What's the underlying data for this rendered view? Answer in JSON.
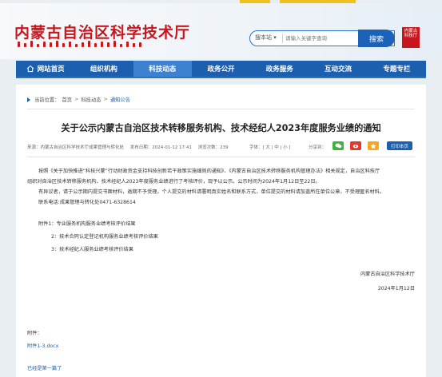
{
  "header": {
    "title": "内蒙古自治区科学技术厅",
    "seal_text": "内蒙古科技厅"
  },
  "search": {
    "scope": "搜本站",
    "placeholder": "请输入关键字查询",
    "button": "搜索"
  },
  "nav": {
    "items": [
      {
        "label": "网站首页"
      },
      {
        "label": "组织机构"
      },
      {
        "label": "科技动态"
      },
      {
        "label": "政务公开"
      },
      {
        "label": "政务服务"
      },
      {
        "label": "互动交流"
      },
      {
        "label": "专题专栏"
      }
    ],
    "active_index": 2
  },
  "breadcrumb": {
    "prefix": "当前位置：",
    "items": [
      "首页",
      "科技动态",
      "通知公告"
    ],
    "separator": ">"
  },
  "article": {
    "title": "关于公示内蒙古自治区技术转移服务机构、技术经纪人2023年度服务业绩的通知",
    "source": "来源：内蒙古自治区科学技术厅成果管理与转化处",
    "published": "发布日期：2024-01-12 17:41",
    "views": "浏览次数：239",
    "font_size_ctl": "字体：[ 大 | 中 | 小 ]",
    "share_label": "分享到：",
    "print_button": "打印本页",
    "paragraphs": [
      "按照《关于加快推进“科技兴蒙”行动财政资金支持科技创新若干政策实施细则的通知》、《内蒙古自治区技术转移服务机构管理办法》相关规定，自治区科技厅",
      "组织对自治区技术转移服务机构、技术经纪人2023年度服务业绩进行了考核评价，现予以公示。公示时间为2024年1月12日至22日。",
      "有异议者，请于公示期内提交书面材料，逾期不予受理。个人提交的材料请署明真实姓名和联系方式，单位提交的材料请加盖所在单位公章，不受理匿名材料。",
      "联系电话:成果管理与转化处0471-6328614"
    ],
    "attachments_intro": "附件1：专业服务机构服务业绩考核评价结果",
    "attachment_items": [
      "2：技术合同认定登记机构服务业绩考核评价结果",
      "3：技术经纪人服务业绩考核评价结果"
    ],
    "signature_org": "内蒙古自治区科学技术厅",
    "signature_date": "2024年1月12日",
    "attachment_label": "附件：",
    "attachment_file": "附件1-3.docx",
    "end_note": "已经是第一篇了"
  },
  "colors": {
    "brand_red": "#c8161d",
    "nav_blue": "#1c5fae",
    "nav_active": "#3d82d0",
    "link_blue": "#1c5fae"
  },
  "icons": {
    "home": "home-icon",
    "wechat": "wechat-icon",
    "weibo": "weibo-icon",
    "qzone": "qzone-icon"
  }
}
